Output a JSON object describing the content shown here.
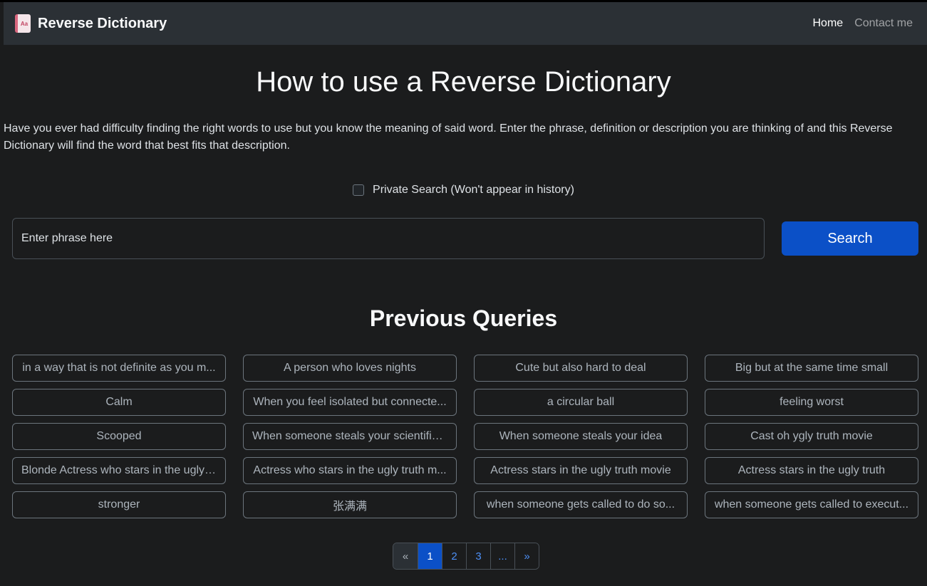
{
  "navbar": {
    "brand": "Reverse Dictionary",
    "brand_icon_text": "Aa",
    "links": [
      {
        "label": "Home",
        "active": true
      },
      {
        "label": "Contact me",
        "active": false
      }
    ]
  },
  "title": "How to use a Reverse Dictionary",
  "intro": "Have you ever had difficulty finding the right words to use but you know the meaning of said word. Enter the phrase, definition or description you are thinking of and this Reverse Dictionary will find the word that best fits that description.",
  "private_search_label": "Private Search (Won't appear in history)",
  "search": {
    "placeholder": "Enter phrase here",
    "button_label": "Search"
  },
  "previous_title": "Previous Queries",
  "queries": [
    "in a way that is not definite as you m...",
    "A person who loves nights",
    "Cute but also hard to deal",
    "Big but at the same time small",
    "Calm",
    "When you feel isolated but connecte...",
    "a circular ball",
    "feeling worst",
    "Scooped",
    "When someone steals your scientific ...",
    "When someone steals your idea",
    "Cast oh ygly truth movie",
    "Blonde Actress who stars in the ugly ...",
    "Actress who stars in the ugly truth m...",
    "Actress stars in the ugly truth movie",
    "Actress stars in the ugly truth",
    "stronger",
    "张满满",
    "when someone gets called to do so...",
    "when someone gets called to execut..."
  ],
  "pagination": [
    "«",
    "1",
    "2",
    "3",
    "...",
    "»"
  ],
  "pagination_active": "1",
  "colors": {
    "background": "#1b1c1d",
    "navbar": "#2b3035",
    "primary": "#0b50c7",
    "link": "#4d8ff5"
  }
}
